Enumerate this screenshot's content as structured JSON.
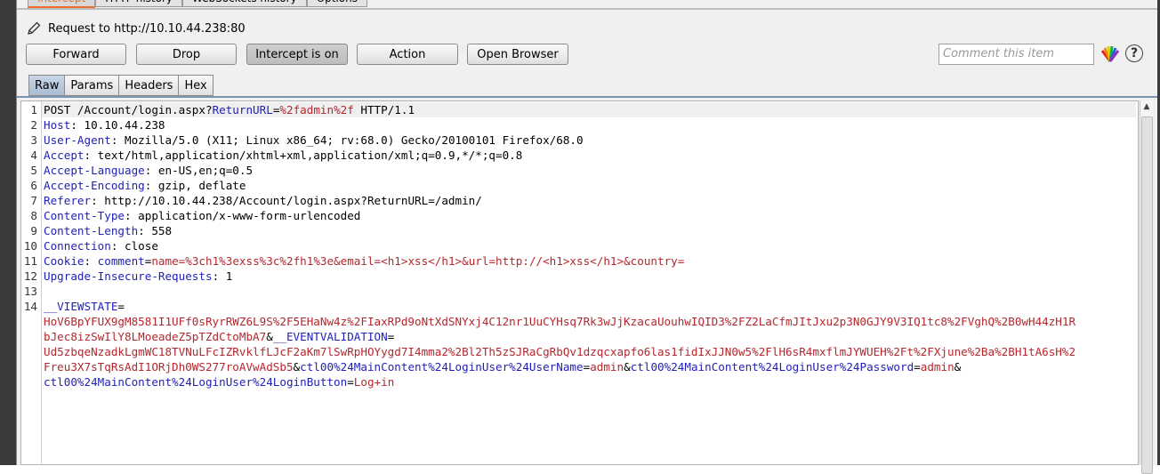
{
  "top_tabs": [
    "Intercept",
    "HTTP history",
    "WebSockets history",
    "Options"
  ],
  "request_label": "Request to http://10.10.44.238:80",
  "buttons": {
    "forward": "Forward",
    "drop": "Drop",
    "intercept": "Intercept is on",
    "action": "Action",
    "open_browser": "Open Browser"
  },
  "comment_placeholder": "Comment this item",
  "help_glyph": "?",
  "sub_tabs": [
    "Raw",
    "Params",
    "Headers",
    "Hex"
  ],
  "icons": {
    "edit": "pencil-icon",
    "highlight": "color-palette-icon",
    "help": "help-icon"
  },
  "colors": {
    "header_key": "#1f1fb8",
    "param_value": "#b4272d",
    "active_tab": "#a9bcd3",
    "accent": "#e8702a"
  },
  "request": {
    "line1": {
      "method_path": "POST /Account/login.aspx?",
      "param": "ReturnURL",
      "eq": "=",
      "value": "%2fadmin%2f",
      "proto": " HTTP/1.1"
    },
    "headers": [
      {
        "key": "Host",
        "value": "10.10.44.238"
      },
      {
        "key": "User-Agent",
        "value": "Mozilla/5.0 (X11; Linux x86_64; rv:68.0) Gecko/20100101 Firefox/68.0"
      },
      {
        "key": "Accept",
        "value": "text/html,application/xhtml+xml,application/xml;q=0.9,*/*;q=0.8"
      },
      {
        "key": "Accept-Language",
        "value": "en-US,en;q=0.5"
      },
      {
        "key": "Accept-Encoding",
        "value": "gzip, deflate"
      },
      {
        "key": "Referer",
        "value": "http://10.10.44.238/Account/login.aspx?ReturnURL=/admin/"
      },
      {
        "key": "Content-Type",
        "value": "application/x-www-form-urlencoded"
      },
      {
        "key": "Content-Length",
        "value": "558"
      },
      {
        "key": "Connection",
        "value": "close"
      }
    ],
    "cookie": {
      "key": "Cookie",
      "name": "comment",
      "value": "name=%3ch1%3exss%3c%2fh1%3e&email=<h1>xss</h1>&url=http://<h1>xss</h1>&country="
    },
    "upgrade": {
      "key": "Upgrade-Insecure-Requests",
      "value": "1"
    },
    "body": {
      "viewstate_key": "__VIEWSTATE",
      "viewstate_1": "HoV6BpYFUX9gM8581I1UFf0sRyrRWZ6L9S%2F5EHaNw4z%2FIaxRPd9oNtXdSNYxj4C12nr1UuCYHsq7Rk3wJjKzacaUouhwIQID3%2FZ2LaCfmJItJxu2p3N0GJY9V3IQ1tc8%2FVghQ%2B0wH44zH1R",
      "viewstate_2": "bJec8izSwIlY8LMoeadeZ5pTZdCtoMbA7",
      "eventval_key": "__EVENTVALIDATION",
      "eventval_1": "Ud5zbqeNzadkLgmWC18TVNuLFcIZRvklfLJcF2aKm7lSwRpHOYygd7I4mma2%2Bl2Th5zSJRaCgRbQv1dzqcxapfo6las1fidIxJJN0w5%2FlH6sR4mxflmJYWUEH%2Ft%2FXjune%2Ba%2BH1tA6sH%2",
      "eventval_2": "Freu3X7sTqRsAdI1ORjDh0WS277roAVwAdSb5",
      "username_key": "ctl00%24MainContent%24LoginUser%24UserName",
      "username": "admin",
      "password_key": "ctl00%24MainContent%24LoginUser%24Password",
      "password": "admin",
      "button_key": "ctl00%24MainContent%24LoginUser%24LoginButton",
      "button": "Log+in"
    }
  }
}
